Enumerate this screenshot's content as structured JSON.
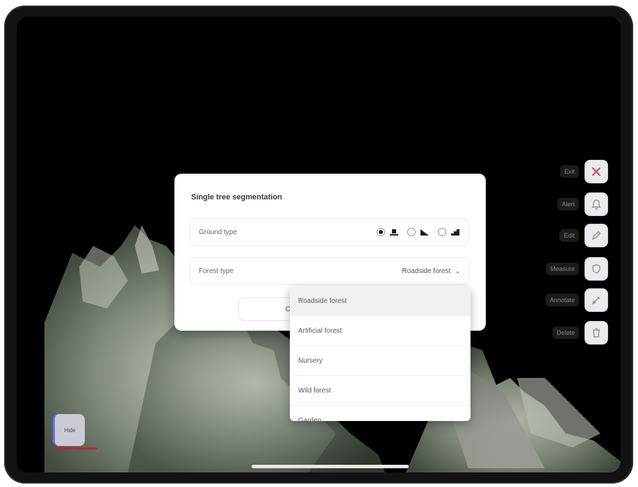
{
  "dialog": {
    "title": "Single tree segmentation",
    "ground_type": {
      "label": "Ground type",
      "options": [
        {
          "icon": "flat-ground-icon",
          "checked": true
        },
        {
          "icon": "slope-ground-icon",
          "checked": false
        },
        {
          "icon": "step-ground-icon",
          "checked": false
        }
      ]
    },
    "forest_type": {
      "label": "Forest type",
      "selected": "Roadside forest"
    },
    "cancel_label": "Canc"
  },
  "dropdown": {
    "items": [
      "Roadside forest",
      "Artificial forest",
      "Nursery",
      "Wild forest",
      "Garden"
    ]
  },
  "toolbar": {
    "items": [
      {
        "label": "Exit",
        "icon": "close-icon"
      },
      {
        "label": "Alert",
        "icon": "bell-icon"
      },
      {
        "label": "Edit",
        "icon": "pen-icon"
      },
      {
        "label": "Measure",
        "icon": "shield-icon"
      },
      {
        "label": "Annotate",
        "icon": "pencil-icon"
      },
      {
        "label": "Delete",
        "icon": "trash-icon"
      }
    ]
  },
  "corner_button": {
    "label": "Hide"
  },
  "colors": {
    "accent_red": "#c0252a",
    "accent_indigo": "#6c6cf0",
    "close_red": "#d64545"
  }
}
